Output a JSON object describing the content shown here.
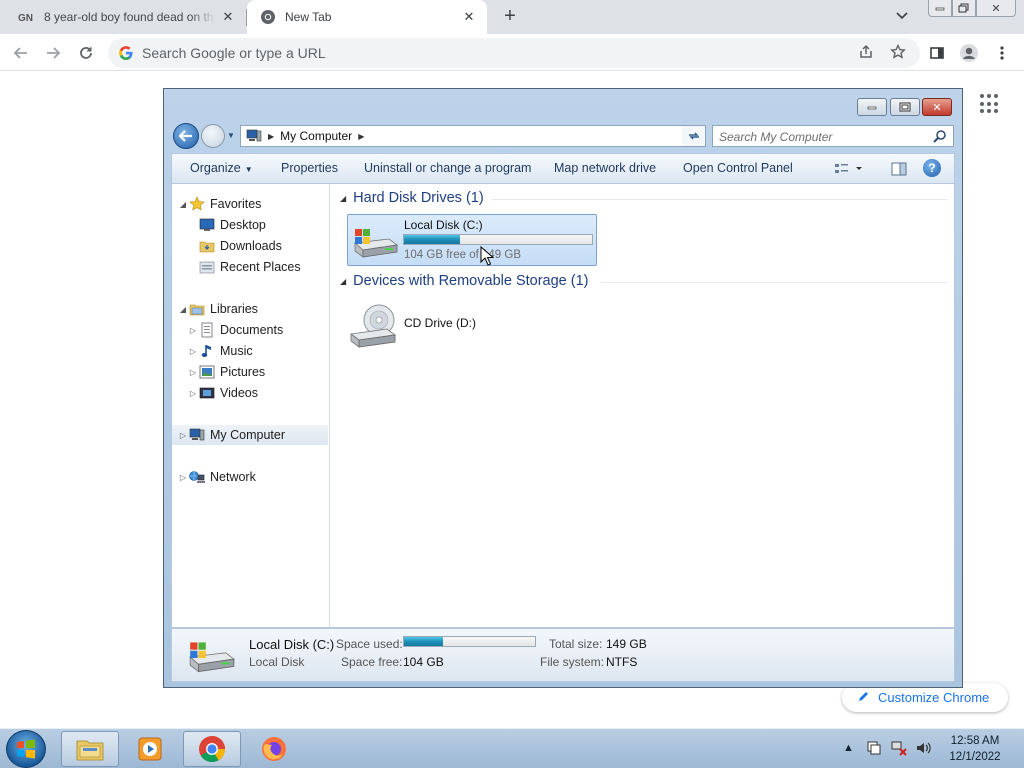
{
  "browser": {
    "tabs": [
      {
        "title": "8 year-old boy found dead on th",
        "favicon": "gn-news-icon"
      },
      {
        "title": "New Tab",
        "favicon": "chrome-icon"
      }
    ],
    "omnibox_placeholder": "Search Google or type a URL",
    "customize_label": "Customize Chrome"
  },
  "explorer": {
    "breadcrumb": "My Computer",
    "search_placeholder": "Search My Computer",
    "commands": {
      "organize": "Organize",
      "properties": "Properties",
      "uninstall": "Uninstall or change a program",
      "map_drive": "Map network drive",
      "control_panel": "Open Control Panel"
    },
    "nav": {
      "favorites": "Favorites",
      "desktop": "Desktop",
      "downloads": "Downloads",
      "recent": "Recent Places",
      "libraries": "Libraries",
      "documents": "Documents",
      "music": "Music",
      "pictures": "Pictures",
      "videos": "Videos",
      "computer": "My Computer",
      "network": "Network"
    },
    "groups": {
      "hdd": "Hard Disk Drives (1)",
      "removable": "Devices with Removable Storage (1)"
    },
    "drive_c": {
      "name": "Local Disk (C:)",
      "free_text": "104 GB free of 149 GB",
      "used_fraction": 0.3
    },
    "drive_d": {
      "name": "CD Drive (D:)"
    },
    "details": {
      "name": "Local Disk (C:)",
      "type": "Local Disk",
      "space_used_label": "Space used:",
      "space_free_label": "Space free:",
      "space_free_value": "104 GB",
      "total_size_label": "Total size:",
      "total_size_value": "149 GB",
      "file_system_label": "File system:",
      "file_system_value": "NTFS"
    }
  },
  "taskbar": {
    "time": "12:58 AM",
    "date": "12/1/2022"
  }
}
